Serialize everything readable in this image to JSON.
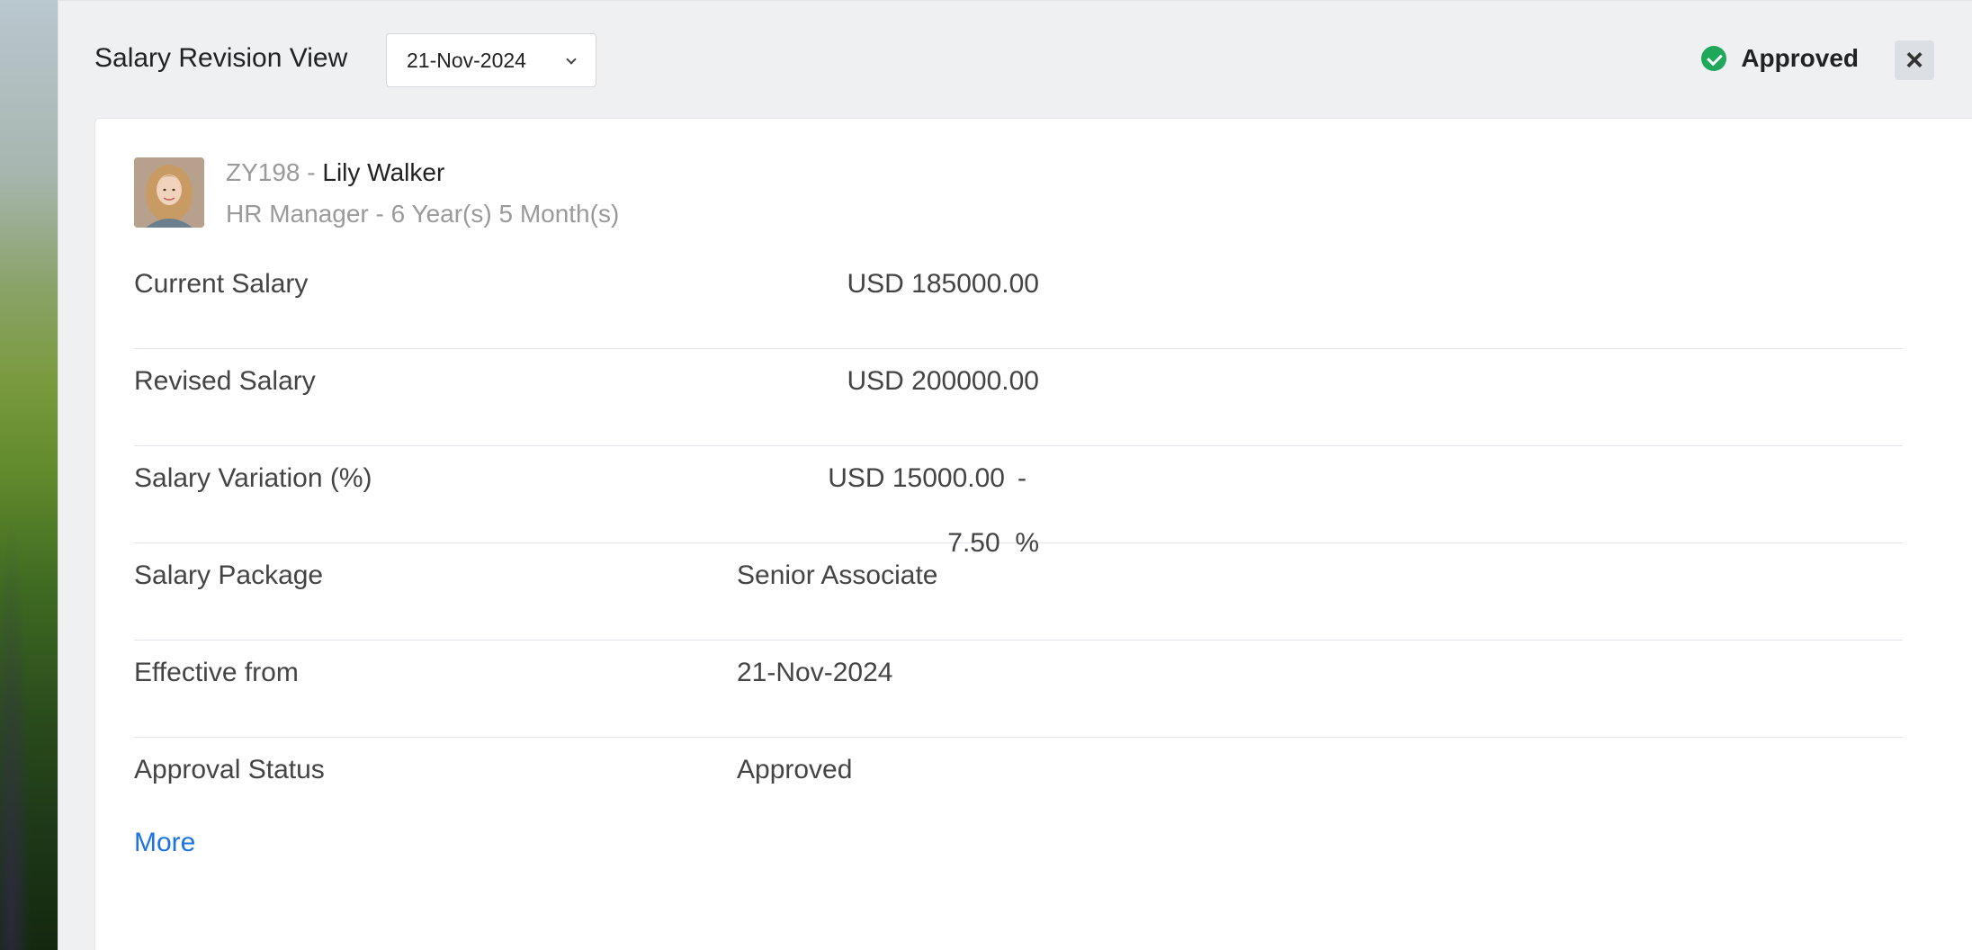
{
  "header": {
    "title": "Salary Revision View",
    "date_selected": "21-Nov-2024",
    "status": "Approved"
  },
  "employee": {
    "id": "ZY198",
    "separator": "-",
    "name": "Lily Walker",
    "role_tenure": "HR Manager - 6 Year(s) 5 Month(s)"
  },
  "rows": [
    {
      "label": "Current Salary",
      "value": "USD 185000.00"
    },
    {
      "label": "Revised Salary",
      "value": "USD 200000.00"
    },
    {
      "label": "Salary Variation (%)",
      "amount": "USD 15000.00",
      "dash": "-",
      "percent": "7.50  %"
    },
    {
      "label": "Salary Package",
      "value": "Senior Associate"
    },
    {
      "label": "Effective from",
      "value": "21-Nov-2024"
    },
    {
      "label": "Approval Status",
      "value": "Approved"
    }
  ],
  "more_label": "More",
  "colors": {
    "approved_green": "#1fa85a",
    "link_blue": "#1a73e8",
    "panel_bg": "#eef0f2"
  }
}
